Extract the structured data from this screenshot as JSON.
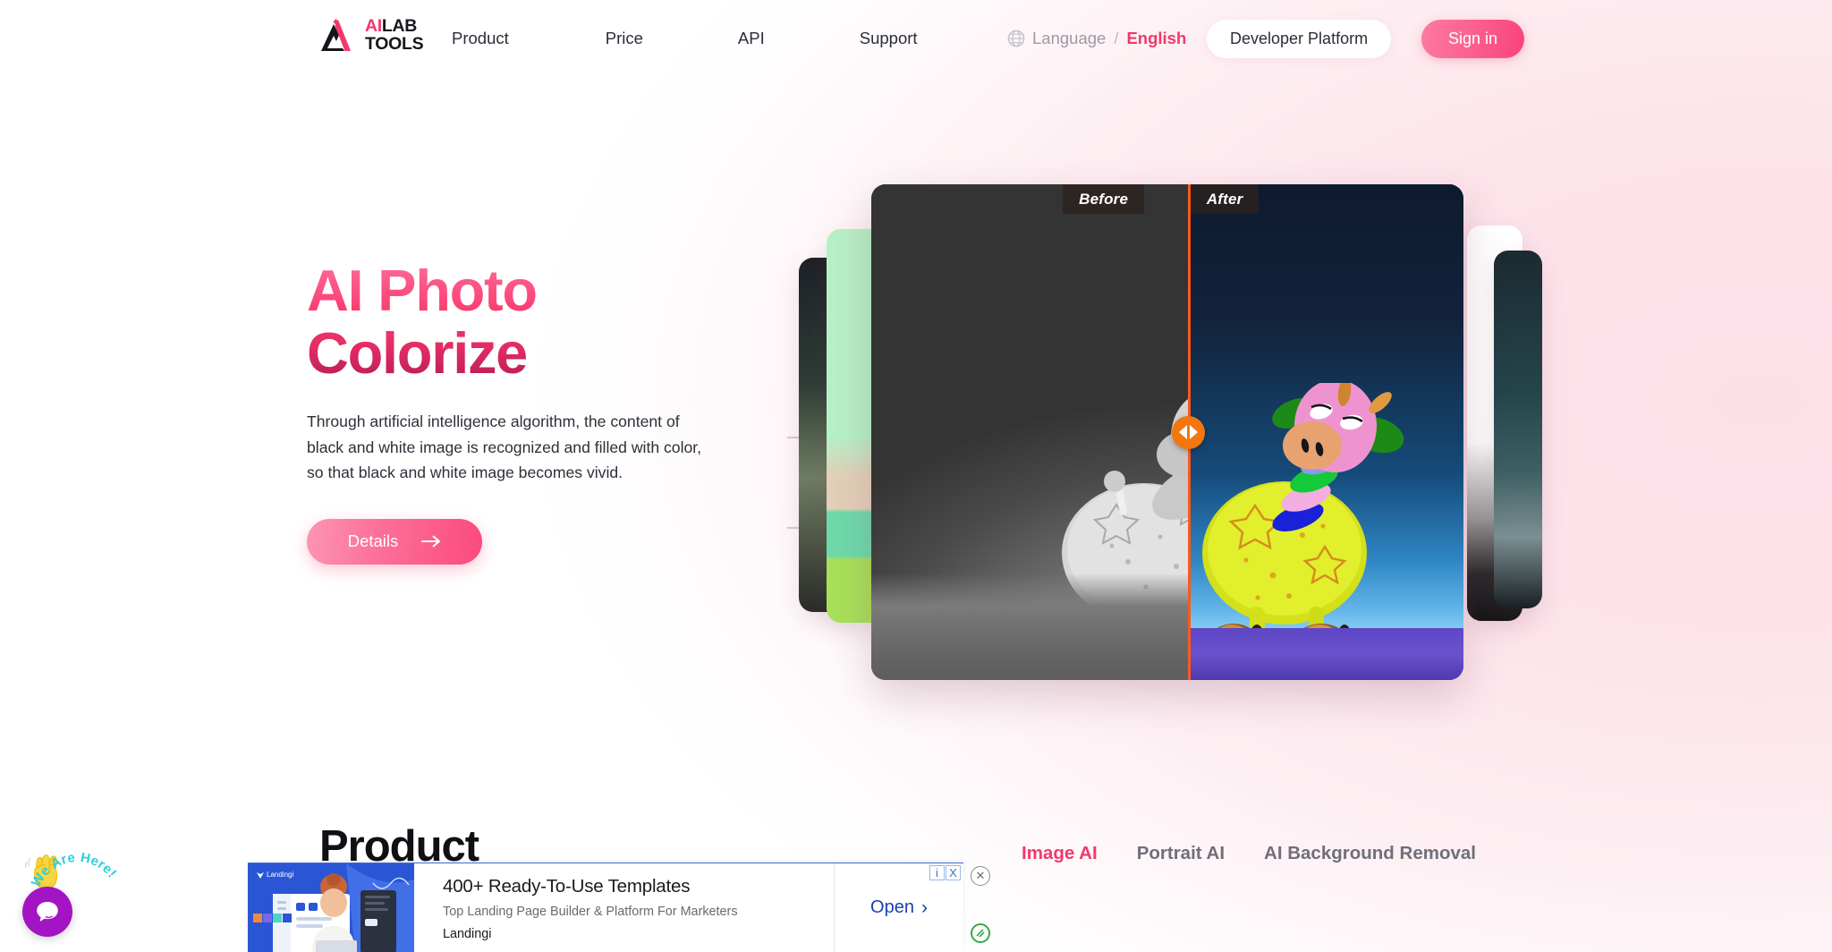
{
  "header": {
    "logo": {
      "line1_accent": "AI",
      "line1_rest": "LAB",
      "line2": "TOOLS",
      "icon": "mountain-a-logo-icon"
    },
    "nav": [
      {
        "label": "Product"
      },
      {
        "label": "Price"
      },
      {
        "label": "API"
      },
      {
        "label": "Support"
      }
    ],
    "language": {
      "icon": "globe-icon",
      "label": "Language",
      "separator": "/",
      "value": "English"
    },
    "developer_platform_label": "Developer Platform",
    "sign_in_label": "Sign in"
  },
  "hero": {
    "title": "AI Photo Colorize",
    "description": "Through artificial intelligence algorithm, the content of black and white image is recognized and filled with color, so that black and white image becomes vivid.",
    "cta_label": "Details",
    "cta_icon": "arrow-right-icon",
    "comparison": {
      "before_label": "Before",
      "after_label": "After",
      "handle_icon": "slider-handle-icon",
      "divider_color": "#ff5a1a",
      "handle_color": "#f4760f",
      "split_percent": "53.5"
    }
  },
  "product": {
    "title": "Product",
    "tabs": [
      {
        "label": "Image AI",
        "active": true
      },
      {
        "label": "Portrait AI",
        "active": false
      },
      {
        "label": "AI Background Removal",
        "active": false
      }
    ]
  },
  "chat": {
    "icon": "chat-bubble-icon",
    "badge_text": "We Are Here!",
    "hand_icon": "waving-hand-icon",
    "color": "#a214c4"
  },
  "ad": {
    "headline": "400+ Ready-To-Use Templates",
    "subline": "Top Landing Page Builder & Platform For Marketers",
    "brand": "Landingi",
    "thumb_brand": "Landingi",
    "cta_label": "Open",
    "cta_icon": "chevron-right-icon",
    "info_icon": "i",
    "dismiss_icon": "X",
    "close_icon": "close-circle-icon",
    "adchoices_icon": "adchoices-icon"
  },
  "colors": {
    "brand_pink": "#f4376d",
    "accent_orange": "#f4760f",
    "page_pink": "#fde0e8",
    "chat_purple": "#a214c4"
  }
}
